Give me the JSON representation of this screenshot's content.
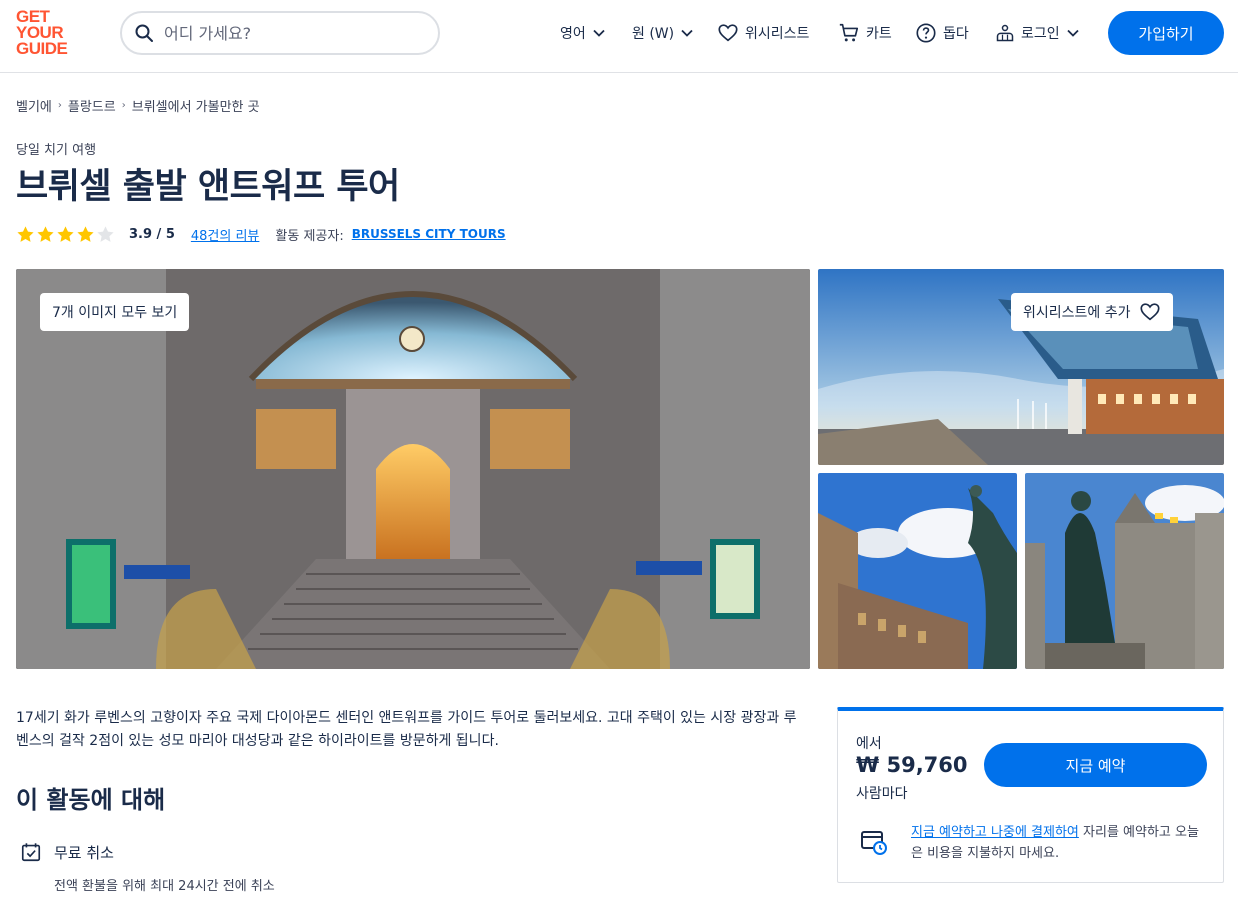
{
  "header": {
    "logo_lines": [
      "GET",
      "YOUR",
      "GUIDE"
    ],
    "search_placeholder": "어디 가세요?",
    "language": "영어",
    "currency": "원 (W)",
    "wishlist": "위시리스트",
    "cart": "카트",
    "help": "돕다",
    "login": "로그인",
    "signup": "가입하기"
  },
  "breadcrumb": [
    "벨기에",
    "플랑드르",
    "브뤼셀에서 가볼만한 곳"
  ],
  "category": "당일 치기 여행",
  "title": "브뤼셀 출발 앤트워프 투어",
  "rating": {
    "stars_filled": 4,
    "stars_total": 5,
    "score": "3.9 / 5",
    "reviews": "48건의 리뷰",
    "provider_label": "활동 제공자:",
    "provider": "BRUSSELS CITY TOURS"
  },
  "gallery": {
    "view_all": "7개 이미지 모두 보기",
    "wishlist_add": "위시리스트에 추가"
  },
  "description": "17세기 화가 루벤스의 고향이자 주요 국제 다이아몬드 센터인 앤트워프를 가이드 투어로 둘러보세요. 고대 주택이 있는 시장 광장과 루벤스의 걸작 2점이 있는 성모 마리아 대성당과 같은 하이라이트를 방문하게 됩니다.",
  "about": {
    "heading": "이 활동에 대해",
    "features": [
      {
        "title": "무료 취소",
        "subtitle": "전액 환불을 위해 최대 24시간 전에 취소"
      }
    ]
  },
  "booking": {
    "from": "에서",
    "price": "₩ 59,760",
    "per": "사람마다",
    "button": "지금 예약",
    "reserve_link": "지금 예약하고 나중에 결제하여",
    "reserve_text": " 자리를 예약하고 오늘은 비용을 지불하지 마세요."
  },
  "colors": {
    "brand_orange": "#ff5533",
    "primary_blue": "#0071eb",
    "text_dark": "#1a2b49",
    "star_yellow": "#ffc600"
  }
}
